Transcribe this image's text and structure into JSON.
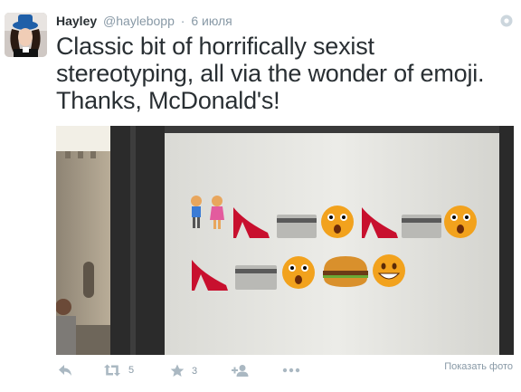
{
  "tweet": {
    "author_name": "Hayley",
    "author_handle": "@hayleboрр",
    "separator": "·",
    "timestamp": "6 июля",
    "text": "Classic bit of horrifically sexist stereotyping, all via the wonder of emoji. Thanks, McDonald's!",
    "retweet_count": "5",
    "favorite_count": "3",
    "show_photo_label": "Показать фото"
  },
  "photo": {
    "emoji_row1": [
      "couple",
      "high-heel",
      "credit-card",
      "scared-face",
      "high-heel",
      "credit-card",
      "scared-face"
    ],
    "emoji_row2": [
      "high-heel",
      "credit-card",
      "scared-face",
      "hamburger",
      "grinning-face"
    ]
  },
  "colors": {
    "text": "#292f33",
    "muted": "#8899a6",
    "icon": "#aab8c2",
    "emoji_face": "#f2a21d",
    "heel": "#c8102e"
  }
}
